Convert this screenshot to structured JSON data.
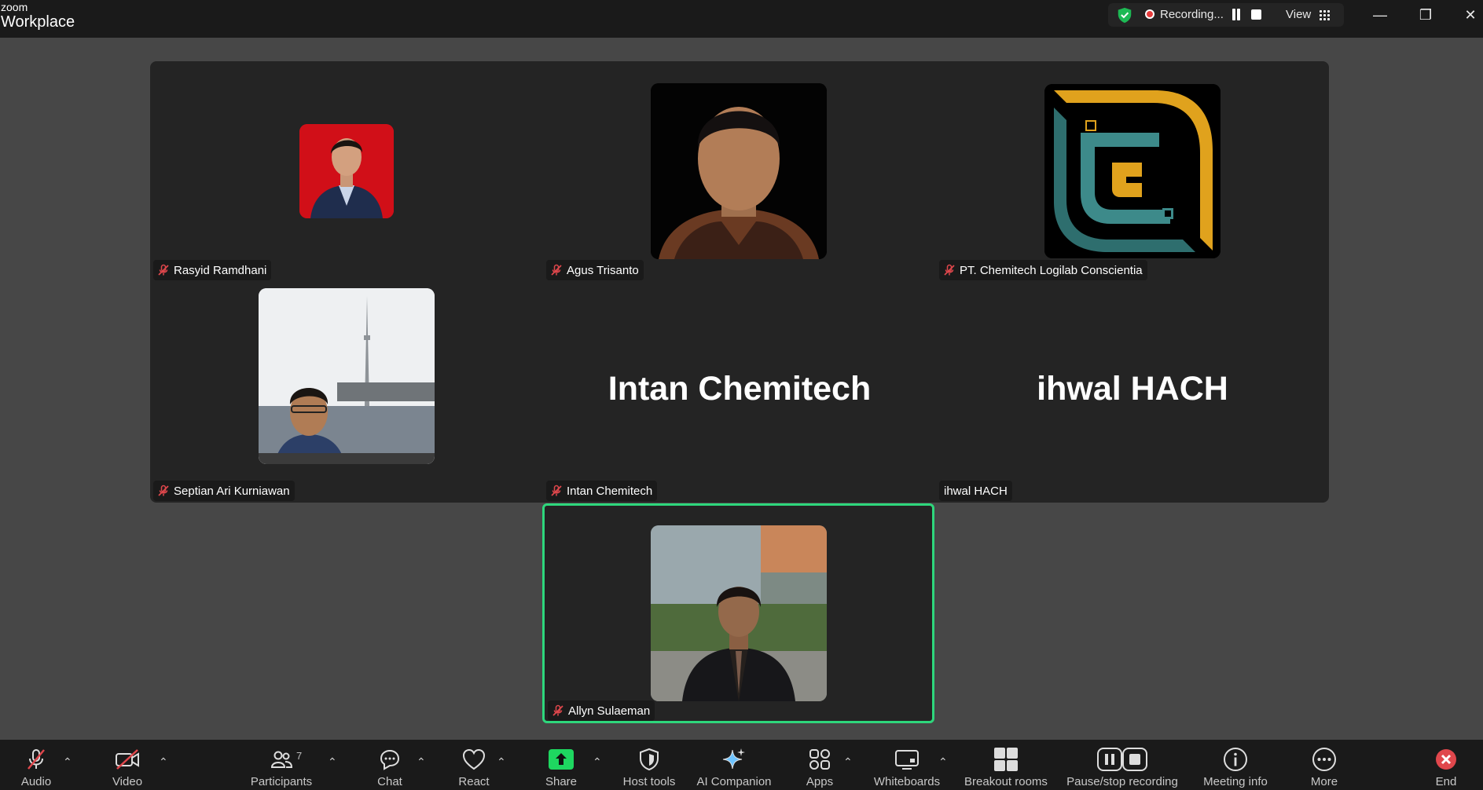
{
  "app": {
    "logo_top": "zoom",
    "logo_bottom": "Workplace"
  },
  "recording": {
    "status": "Recording...",
    "view_label": "View"
  },
  "window_controls": {
    "minimize": "—",
    "restore": "❐",
    "close": "✕"
  },
  "participants": [
    {
      "name": "Rasyid Ramdhani",
      "muted": true,
      "avatar": "photo"
    },
    {
      "name": "Agus Trisanto",
      "muted": true,
      "avatar": "photo"
    },
    {
      "name": "PT. Chemitech Logilab Conscientia",
      "muted": true,
      "avatar": "logo"
    },
    {
      "name": "Septian Ari Kurniawan",
      "muted": true,
      "avatar": "photo"
    },
    {
      "name": "Intan Chemitech",
      "muted": true,
      "avatar": "text",
      "display_text": "Intan Chemitech"
    },
    {
      "name": "ihwal HACH",
      "muted": false,
      "avatar": "text",
      "display_text": "ihwal HACH"
    }
  ],
  "active_speaker": {
    "name": "Allyn Sulaeman",
    "muted": true,
    "highlight_color": "#2ed77c"
  },
  "toolbar": {
    "audio": "Audio",
    "video": "Video",
    "participants": "Participants",
    "participants_count": "7",
    "chat": "Chat",
    "react": "React",
    "share": "Share",
    "host_tools": "Host tools",
    "ai_companion": "AI Companion",
    "apps": "Apps",
    "whiteboards": "Whiteboards",
    "breakout_rooms": "Breakout rooms",
    "pause_stop_recording": "Pause/stop recording",
    "meeting_info": "Meeting info",
    "more": "More",
    "end": "End"
  },
  "colors": {
    "share_green": "#1ed760",
    "muted_red": "#e0474c",
    "background": "#474747",
    "tile": "#242424"
  }
}
